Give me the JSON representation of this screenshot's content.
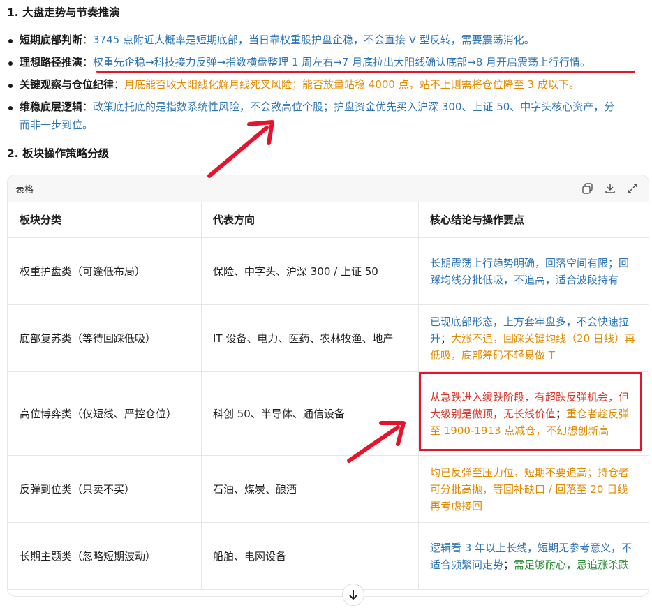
{
  "section1": {
    "heading": "1. 大盘走势与节奏推演",
    "items": [
      {
        "key": "短期底部判断",
        "sep": "：",
        "segments": [
          {
            "text": "3745 点附近大概率是短期底部，当日靠权重股护盘企稳，不会直接 V 型反转，需要震荡消化。",
            "color": "blue"
          }
        ]
      },
      {
        "key": "理想路径推演",
        "sep": "：",
        "segments": [
          {
            "text": "权重先企稳→科技接力反弹→指数横盘整理 1 周左右→7 月底拉出大阳线确认底部→8 月开启震荡上行行情。",
            "color": "blue"
          }
        ]
      },
      {
        "key": "关键观察与仓位纪律",
        "sep": "：",
        "segments": [
          {
            "text": "月底能否收大阳线化解月线死叉风险；能否放量站稳 4000 点，站不上则需将仓位降至 3 成以下。",
            "color": "orange"
          }
        ]
      },
      {
        "key": "维稳底层逻辑",
        "sep": "：",
        "segments": [
          {
            "text": "政策底托底的是指数系统性风险，不会救高位个股；护盘资金优先买入沪深 300、上证 50、中字头核心资产，分",
            "color": "blue"
          }
        ],
        "continuation": "而非一步到位。"
      }
    ]
  },
  "section2": {
    "heading": "2. 板块操作策略分级"
  },
  "table_card": {
    "title": "表格",
    "icons": [
      "copy-icon",
      "download-icon",
      "expand-icon"
    ],
    "headers": [
      "板块分类",
      "代表方向",
      "核心结论与操作要点"
    ],
    "rows": [
      {
        "category": "权重护盘类（可逢低布局）",
        "direction": "保险、中字头、沪深 300 / 上证 50",
        "conclusion": [
          {
            "text": "长期震荡上行趋势明确，回落空间有限；回踩均线分批低吸，不追高，适合波段持有",
            "color": "blue"
          }
        ]
      },
      {
        "category": "底部复苏类（等待回踩低吸）",
        "direction": "IT 设备、电力、医药、农林牧渔、地产",
        "conclusion": [
          {
            "text": "已现底部形态，上方套牢盘多，不会快速拉升",
            "color": "blue"
          },
          {
            "text": "；",
            "color": "dark"
          },
          {
            "text": "大涨不追，回踩关键均线（20 日线）再低吸，底部筹码不轻易做 T",
            "color": "orange"
          }
        ]
      },
      {
        "category": "高位博弈类（仅短线、严控仓位）",
        "direction": "科创 50、半导体、通信设备",
        "conclusion": [
          {
            "text": "从急跌进入缓跌阶段，有超跌反弹机会，但大级别是做顶，无长线价值",
            "color": "red"
          },
          {
            "text": "；",
            "color": "dark"
          },
          {
            "text": "重仓者趁反弹至 1900-1913 点减仓，不幻想创新高",
            "color": "orange"
          }
        ]
      },
      {
        "category": "反弹到位类（只卖不买）",
        "direction": "石油、煤炭、酿酒",
        "conclusion": [
          {
            "text": "均已反弹至压力位，短期不要追高；持仓者可分批高抛，等回补缺口 / 回落至 20 日线再考虑接回",
            "color": "orange"
          }
        ]
      },
      {
        "category": "长期主题类（忽略短期波动）",
        "direction": "船舶、电网设备",
        "conclusion": [
          {
            "text": "逻辑看 3 年以上长线，短期无参考意义，不适合频繁问走势",
            "color": "blue"
          },
          {
            "text": "；",
            "color": "dark"
          },
          {
            "text": "需足够耐心，忌追涨杀跌",
            "color": "green"
          }
        ]
      }
    ]
  },
  "annotations": {
    "underline_color": "#e8122a",
    "box_color": "#e8122a",
    "arrow_color": "#e8122a"
  },
  "colors": {
    "blue": "#2e75b6",
    "orange": "#e08a00",
    "red": "#d9362b",
    "green": "#2e8b3a",
    "dark": "#1f1f1f"
  }
}
